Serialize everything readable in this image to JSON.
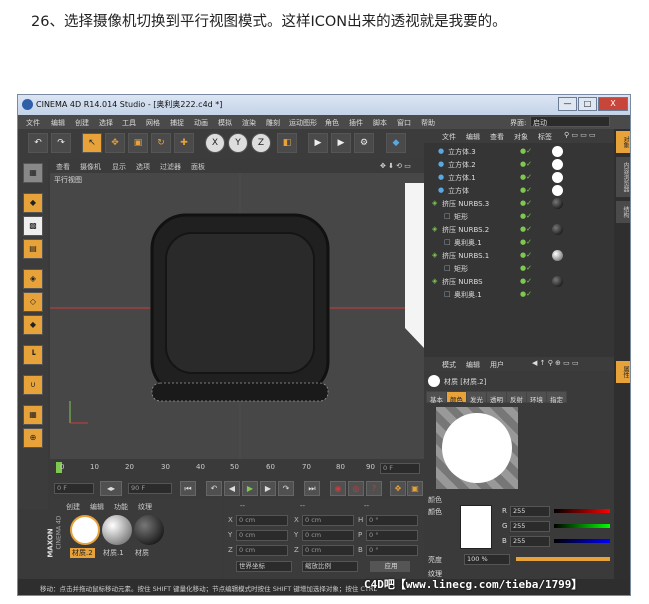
{
  "caption": "26、选择摄像机切换到平行视图模式。这样ICON出来的透视就是我要的。",
  "window": {
    "title": "CINEMA 4D R14.014 Studio - [奥利奥222.c4d *]",
    "min": "—",
    "max": "□",
    "close": "X"
  },
  "menu": [
    "文件",
    "编辑",
    "创建",
    "选择",
    "工具",
    "网格",
    "捕捉",
    "动画",
    "模拟",
    "渲染",
    "雕刻",
    "运动图形",
    "角色",
    "插件",
    "脚本",
    "窗口",
    "帮助"
  ],
  "interface_label": "界面:",
  "interface_value": "启动",
  "toolbar": {
    "x": "X",
    "y": "Y",
    "z": "Z"
  },
  "viewport": {
    "menu": [
      "查看",
      "摄像机",
      "显示",
      "选项",
      "过滤器",
      "面板"
    ],
    "label": "平行视图"
  },
  "timeline": {
    "ticks": [
      "0",
      "10",
      "20",
      "30",
      "40",
      "50",
      "60",
      "70",
      "80",
      "90"
    ],
    "frame_end": "0 F"
  },
  "transport": {
    "start": "0 F",
    "end": "90 F"
  },
  "materials": {
    "menu": [
      "创建",
      "编辑",
      "功能",
      "纹理"
    ],
    "items": [
      "材质.2",
      "材质.1",
      "材质"
    ],
    "brand1": "MAXON",
    "brand2": "CINEMA 4D"
  },
  "coords": {
    "header": [
      "--",
      "--",
      "--"
    ],
    "rows": [
      {
        "a": "X",
        "av": "0 cm",
        "b": "X",
        "bv": "0 cm",
        "c": "H",
        "cv": "0 °"
      },
      {
        "a": "Y",
        "av": "0 cm",
        "b": "Y",
        "bv": "0 cm",
        "c": "P",
        "cv": "0 °"
      },
      {
        "a": "Z",
        "av": "0 cm",
        "b": "Z",
        "bv": "0 cm",
        "c": "B",
        "cv": "0 °"
      }
    ],
    "space": "世界坐标",
    "scale": "缩放比例",
    "apply": "应用"
  },
  "objects": {
    "menu": [
      "文件",
      "编辑",
      "查看",
      "对象",
      "标签"
    ],
    "rows": [
      {
        "name": "立方体.3",
        "indent": 1
      },
      {
        "name": "立方体.2",
        "indent": 1
      },
      {
        "name": "立方体.1",
        "indent": 1
      },
      {
        "name": "立方体",
        "indent": 1
      },
      {
        "name": "挤压 NURBS.3",
        "indent": 0
      },
      {
        "name": "矩形",
        "indent": 2
      },
      {
        "name": "挤压 NURBS.2",
        "indent": 0
      },
      {
        "name": "奥利奥.1",
        "indent": 2
      },
      {
        "name": "挤压 NURBS.1",
        "indent": 0
      },
      {
        "name": "矩形",
        "indent": 2
      },
      {
        "name": "挤压 NURBS",
        "indent": 0
      },
      {
        "name": "奥利奥.1",
        "indent": 2
      }
    ]
  },
  "right_tabs": [
    "对象",
    "内容浏览器",
    "结构"
  ],
  "attributes": {
    "menu": [
      "模式",
      "编辑",
      "用户"
    ],
    "side_tab": "属性",
    "material_title": "材质 [材质.2]",
    "tabs": [
      "基本",
      "颜色",
      "发光",
      "透明",
      "反射",
      "环境",
      "指定"
    ],
    "section": "颜色",
    "color_label": "颜色",
    "r": "255",
    "g": "255",
    "b": "255",
    "brightness_label": "亮度",
    "brightness": "100 %",
    "texture_label": "纹理"
  },
  "status": "移动：点击并拖动鼠标移动元素。按住 SHIFT 键量化移动；节点编辑模式时按住 SHIFT 键增加选择对象；按住 CTRL",
  "watermark": "C4D吧【www.linecg.com/tieba/1799】",
  "colors": {
    "accent": "#e8a23a",
    "bg": "#3a3a3a",
    "title": "#c4d3e8"
  }
}
